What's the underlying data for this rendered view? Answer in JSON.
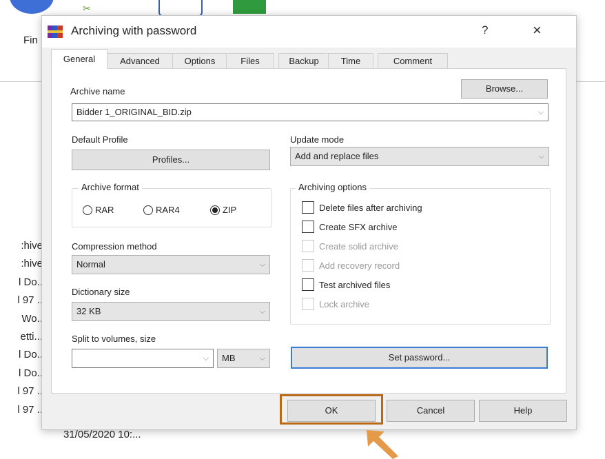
{
  "background": {
    "fin_label": "Fin",
    "list_items": [
      ":hive",
      ":hive",
      "l Do..",
      "l 97 ..",
      " Wo..",
      "etti...",
      "l Do..",
      "l Do..",
      "l 97 ..",
      "l 97 .."
    ],
    "date_text": "31/05/2020 10:..."
  },
  "dialog": {
    "title": "Archiving with password",
    "help_glyph": "?",
    "close_glyph": "×",
    "tabs": [
      "General",
      "Advanced",
      "Options",
      "Files",
      "Backup",
      "Time",
      "Comment"
    ],
    "active_tab": "General",
    "archive_name": {
      "label": "Archive name",
      "value": "Bidder 1_ORIGINAL_BID.zip",
      "browse_label": "Browse..."
    },
    "default_profile": {
      "label": "Default Profile",
      "button_label": "Profiles..."
    },
    "update_mode": {
      "label": "Update mode",
      "value": "Add and replace files"
    },
    "archive_format": {
      "title": "Archive format",
      "options": [
        "RAR",
        "RAR4",
        "ZIP"
      ],
      "selected": "ZIP"
    },
    "archiving_options": {
      "title": "Archiving options",
      "items": [
        {
          "label": "Delete files after archiving",
          "enabled": true,
          "checked": false
        },
        {
          "label": "Create SFX archive",
          "enabled": true,
          "checked": false
        },
        {
          "label": "Create solid archive",
          "enabled": false,
          "checked": false
        },
        {
          "label": "Add recovery record",
          "enabled": false,
          "checked": false
        },
        {
          "label": "Test archived files",
          "enabled": true,
          "checked": false
        },
        {
          "label": "Lock archive",
          "enabled": false,
          "checked": false
        }
      ]
    },
    "compression_method": {
      "label": "Compression method",
      "value": "Normal"
    },
    "dictionary_size": {
      "label": "Dictionary size",
      "value": "32 KB"
    },
    "split_volumes": {
      "label": "Split to volumes, size",
      "value": "",
      "unit": "MB"
    },
    "set_password_label": "Set password...",
    "footer": {
      "ok_label": "OK",
      "cancel_label": "Cancel",
      "help_label": "Help"
    }
  },
  "colors": {
    "highlight_box": "#b86a18",
    "arrow": "#e59a4a",
    "focus_border": "#3a7bd5"
  },
  "icons": {
    "dropdown": "chevron-down-icon",
    "app": "winrar-icon",
    "pointer": "orange-arrow-icon"
  }
}
